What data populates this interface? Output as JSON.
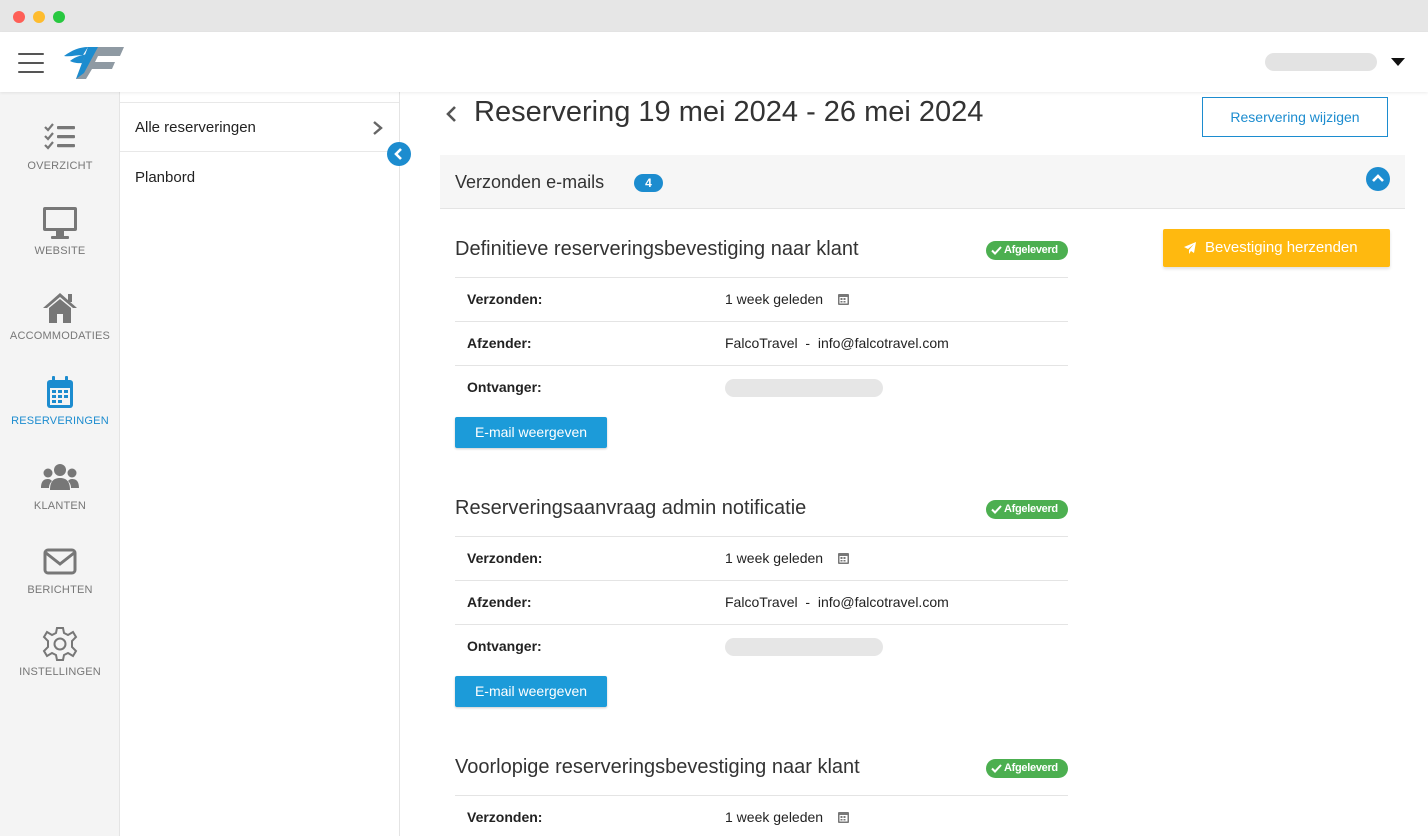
{
  "brand": {
    "accent": "#1c8ccf",
    "warning": "#ffb90f",
    "success": "#4caf50"
  },
  "sidebar": {
    "items": [
      {
        "label": "OVERZICHT",
        "icon": "checklist-icon"
      },
      {
        "label": "WEBSITE",
        "icon": "monitor-icon"
      },
      {
        "label": "ACCOMMODATIES",
        "icon": "home-icon"
      },
      {
        "label": "RESERVERINGEN",
        "icon": "calendar-icon",
        "active": true
      },
      {
        "label": "KLANTEN",
        "icon": "users-icon"
      },
      {
        "label": "BERICHTEN",
        "icon": "envelope-icon"
      },
      {
        "label": "INSTELLINGEN",
        "icon": "gear-icon"
      }
    ]
  },
  "subnav": {
    "items": [
      {
        "label": "Alle reserveringen"
      },
      {
        "label": "Planbord"
      }
    ]
  },
  "header": {
    "title": "Reservering 19 mei 2024 - 26 mei 2024",
    "edit_label": "Reservering wijzigen"
  },
  "panel": {
    "title": "Verzonden e-mails",
    "count": "4",
    "resend_label": "Bevestiging herzenden"
  },
  "emails": [
    {
      "title": "Definitieve reserveringsbevestiging naar klant",
      "status": "Afgeleverd",
      "sent_label": "Verzonden:",
      "sent_value": "1 week geleden",
      "sender_label": "Afzender:",
      "sender_value": "FalcoTravel  -  info@falcotravel.com",
      "recipient_label": "Ontvanger:",
      "view_label": "E-mail weergeven"
    },
    {
      "title": "Reserveringsaanvraag admin notificatie",
      "status": "Afgeleverd",
      "sent_label": "Verzonden:",
      "sent_value": "1 week geleden",
      "sender_label": "Afzender:",
      "sender_value": "FalcoTravel  -  info@falcotravel.com",
      "recipient_label": "Ontvanger:",
      "view_label": "E-mail weergeven"
    },
    {
      "title": "Voorlopige reserveringsbevestiging naar klant",
      "status": "Afgeleverd",
      "sent_label": "Verzonden:",
      "sent_value": "1 week geleden"
    }
  ]
}
